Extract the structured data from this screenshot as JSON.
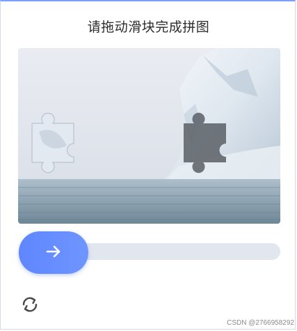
{
  "captcha": {
    "title": "请拖动滑块完成拼图",
    "slider": {
      "progress": 0.0
    }
  },
  "icons": {
    "slider_arrow": "arrow-right-icon",
    "refresh": "refresh-icon"
  },
  "colors": {
    "accent": "#6a8dff",
    "track": "#e2e6ef",
    "frame_top": "#7aa0ff"
  },
  "footer": {
    "watermark": "CSDN @2766958292"
  }
}
